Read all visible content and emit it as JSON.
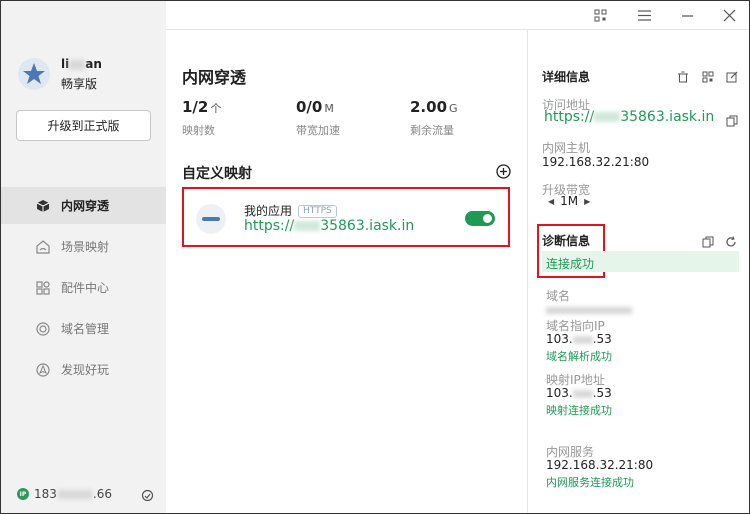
{
  "user": {
    "name_prefix": "li",
    "name_suffix": "an",
    "edition": "畅享版",
    "upgrade_label": "升级到正式版"
  },
  "sidebar": {
    "items": [
      {
        "label": "内网穿透",
        "icon": "cube-icon",
        "active": true
      },
      {
        "label": "场景映射",
        "icon": "house-icon",
        "active": false
      },
      {
        "label": "配件中心",
        "icon": "grid-icon",
        "active": false
      },
      {
        "label": "域名管理",
        "icon": "domain-icon",
        "active": false
      },
      {
        "label": "发现好玩",
        "icon": "compass-icon",
        "active": false
      }
    ],
    "ip_prefix": "183",
    "ip_suffix": ".66",
    "ip_badge": "IP"
  },
  "main": {
    "title": "内网穿透",
    "stats": [
      {
        "value": "1/2",
        "unit": "个",
        "label": "映射数"
      },
      {
        "value": "0/0",
        "unit": "M",
        "label": "带宽加速"
      },
      {
        "value": "2.00",
        "unit": "G",
        "label": "剩余流量"
      }
    ],
    "section_title": "自定义映射",
    "app": {
      "name": "我的应用",
      "badge": "HTTPS",
      "url_prefix": "https://",
      "url_suffix": "35863.iask.in",
      "enabled": true
    }
  },
  "detail": {
    "title": "详细信息",
    "access_label": "访问地址",
    "access_prefix": "https://",
    "access_suffix": "35863.iask.in",
    "host_label": "内网主机",
    "host_value": "192.168.32.21:80",
    "bandwidth_label": "升级带宽",
    "bandwidth_value": "1M"
  },
  "diagnosis": {
    "title": "诊断信息",
    "status": "连接成功",
    "domain_label": "域名",
    "domain_ip_label": "域名指向IP",
    "domain_ip_prefix": "103.",
    "domain_ip_suffix": ".53",
    "domain_ip_status": "域名解析成功",
    "map_ip_label": "映射IP地址",
    "map_ip_prefix": "103.",
    "map_ip_suffix": ".53",
    "map_ip_status": "映射连接成功",
    "service_label": "内网服务",
    "service_value": "192.168.32.21:80",
    "service_status": "内网服务连接成功"
  },
  "colors": {
    "accent": "#1f9a55",
    "highlight_border": "#e0141e",
    "sidebar_bg": "#f2f2f2"
  }
}
